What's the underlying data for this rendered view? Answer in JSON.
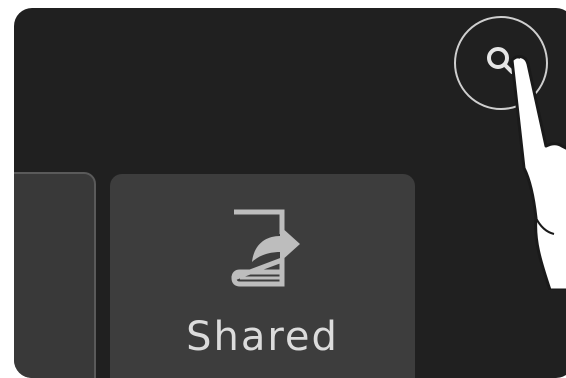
{
  "tiles": {
    "shared": {
      "label": "Shared",
      "icon": "shared-book-icon"
    }
  },
  "search": {
    "icon": "search-icon"
  },
  "overlay": {
    "icon": "hand-pointer-icon"
  },
  "colors": {
    "background": "#202020",
    "tile": "#3d3d3d",
    "icon": "#bdbdbd",
    "text": "#dcdcdc"
  }
}
